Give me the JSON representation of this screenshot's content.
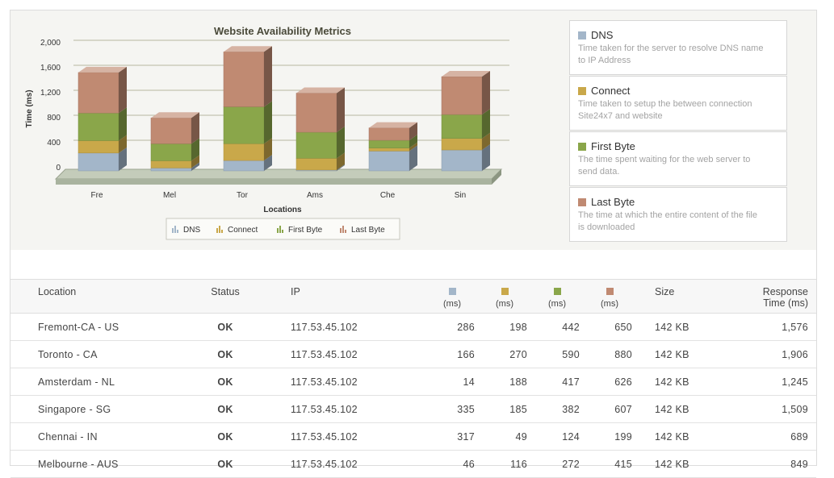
{
  "chart_data": {
    "type": "bar",
    "stacked": true,
    "title": "Website Availability Metrics",
    "xlabel": "Locations",
    "ylabel": "Time (ms)",
    "ylim": [
      0,
      2000
    ],
    "yticks": [
      "0",
      "400",
      "800",
      "1,200",
      "1,600",
      "2,000"
    ],
    "categories": [
      "Fre",
      "Mel",
      "Tor",
      "Ams",
      "Che",
      "Sin"
    ],
    "series": [
      {
        "name": "DNS",
        "color": "#a3b6c9",
        "values": [
          286,
          46,
          166,
          14,
          317,
          335
        ]
      },
      {
        "name": "Connect",
        "color": "#c9a84a",
        "values": [
          198,
          116,
          270,
          188,
          49,
          185
        ]
      },
      {
        "name": "First Byte",
        "color": "#8aa64a",
        "values": [
          442,
          272,
          590,
          417,
          124,
          382
        ]
      },
      {
        "name": "Last Byte",
        "color": "#c08a72",
        "values": [
          650,
          415,
          880,
          626,
          199,
          607
        ]
      }
    ],
    "legend": "bottom"
  },
  "side_legend": [
    {
      "title": "DNS",
      "color": "#a3b6c9",
      "desc1": "Time taken for the server to resolve DNS name",
      "desc2": "to IP Address"
    },
    {
      "title": "Connect",
      "color": "#c9a84a",
      "desc1": "Time taken to setup the between connection",
      "desc2": "Site24x7 and website"
    },
    {
      "title": "First Byte",
      "color": "#8aa64a",
      "desc1": "The time spent waiting for the web server to",
      "desc2": "send data."
    },
    {
      "title": "Last Byte",
      "color": "#c08a72",
      "desc1": "The time at which the entire content of the file",
      "desc2": "is downloaded"
    }
  ],
  "table": {
    "headers": {
      "location": "Location",
      "status": "Status",
      "ip": "IP",
      "unit": "(ms)",
      "size": "Size",
      "response1": "Response",
      "response2": "Time (ms)"
    },
    "rows": [
      {
        "location": "Fremont-CA - US",
        "status": "OK",
        "ip": "117.53.45.102",
        "dns": "286",
        "connect": "198",
        "first": "442",
        "last": "650",
        "size": "142 KB",
        "response": "1,576"
      },
      {
        "location": "Toronto - CA",
        "status": "OK",
        "ip": "117.53.45.102",
        "dns": "166",
        "connect": "270",
        "first": "590",
        "last": "880",
        "size": "142 KB",
        "response": "1,906"
      },
      {
        "location": "Amsterdam - NL",
        "status": "OK",
        "ip": "117.53.45.102",
        "dns": "14",
        "connect": "188",
        "first": "417",
        "last": "626",
        "size": "142 KB",
        "response": "1,245"
      },
      {
        "location": "Singapore - SG",
        "status": "OK",
        "ip": "117.53.45.102",
        "dns": "335",
        "connect": "185",
        "first": "382",
        "last": "607",
        "size": "142 KB",
        "response": "1,509"
      },
      {
        "location": "Chennai - IN",
        "status": "OK",
        "ip": "117.53.45.102",
        "dns": "317",
        "connect": "49",
        "first": "124",
        "last": "199",
        "size": "142 KB",
        "response": "689"
      },
      {
        "location": "Melbourne - AUS",
        "status": "OK",
        "ip": "117.53.45.102",
        "dns": "46",
        "connect": "116",
        "first": "272",
        "last": "415",
        "size": "142 KB",
        "response": "849"
      }
    ]
  }
}
